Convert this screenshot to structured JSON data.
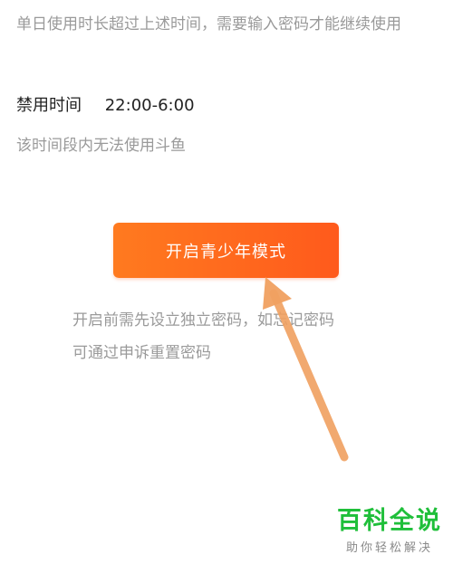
{
  "description": "单日使用时长超过上述时间，需要输入密码才能继续使用",
  "ban": {
    "label": "禁用时间",
    "time": "22:00-6:00",
    "note": "该时间段内无法使用斗鱼"
  },
  "enable_button": {
    "label": "开启青少年模式",
    "color": "#ff6a1f"
  },
  "hint": {
    "line1": "开启前需先设立独立密码，如忘记密码",
    "line2": "可通过申诉重置密码"
  },
  "annotation": {
    "arrow_color": "#f0a060"
  },
  "watermark": {
    "title": "百科全说",
    "subtitle": "助你轻松解决",
    "color": "#1fbf3a"
  }
}
